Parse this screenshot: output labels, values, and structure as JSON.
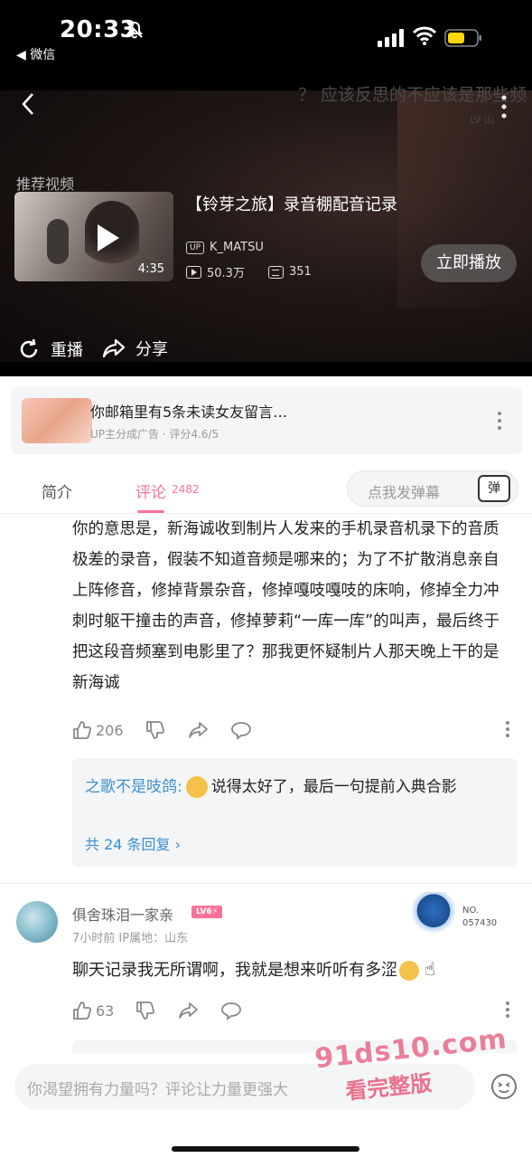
{
  "status": {
    "time": "20:33",
    "back_app": "◀ 微信"
  },
  "video": {
    "overlay_title": "？ 应该反思的不应该是那些频",
    "overlay_sub": "LV·山",
    "recommend_label": "推荐视频",
    "duration": "4:35",
    "title": "【铃芽之旅】录音棚配音记录",
    "up_badge": "UP",
    "uploader": "K_MATSU",
    "views": "50.3万",
    "danmaku_count": "351",
    "play_now": "立即播放",
    "replay": "重播",
    "share": "分享"
  },
  "ad": {
    "title": "你邮箱里有5条未读女友留言…",
    "sub": "UP主分成广告 · 评分4.6/5"
  },
  "tabs": {
    "intro": "简介",
    "comments": "评论",
    "comment_count": "2482",
    "danmaku_placeholder": "点我发弹幕",
    "danmaku_btn": "弹"
  },
  "comment1": {
    "text": "你的意思是，新海诚收到制片人发来的手机录音机录下的音质极差的录音，假装不知道音频是哪来的；为了不扩散消息亲自上阵修音，修掉背景杂音，修掉嘎吱嘎吱的床响，修掉全力冲刺时躯干撞击的声音，修掉萝莉“一库一库”的叫声，最后终于把这段音频塞到电影里了？那我更怀疑制片人那天晚上干的是新海诚",
    "likes": "206",
    "reply": {
      "user": "之歌不是吱鸽:",
      "text": "说得太好了，最后一句提前入典合影",
      "total": "共 24 条回复 ›"
    }
  },
  "comment2": {
    "user": "俱舍珠泪一家亲",
    "level": "LV6⚡",
    "meta": "7小时前  IP属地：山东",
    "no_label": "NO.",
    "no_value": "057430",
    "text": "聊天记录我无所谓啊，我就是想来听听有多涩",
    "likes": "63"
  },
  "bottom": {
    "placeholder": "你渴望拥有力量吗？评论让力量更强大"
  },
  "watermark": {
    "line1": "91ds10.com",
    "line2": "看完整版"
  }
}
